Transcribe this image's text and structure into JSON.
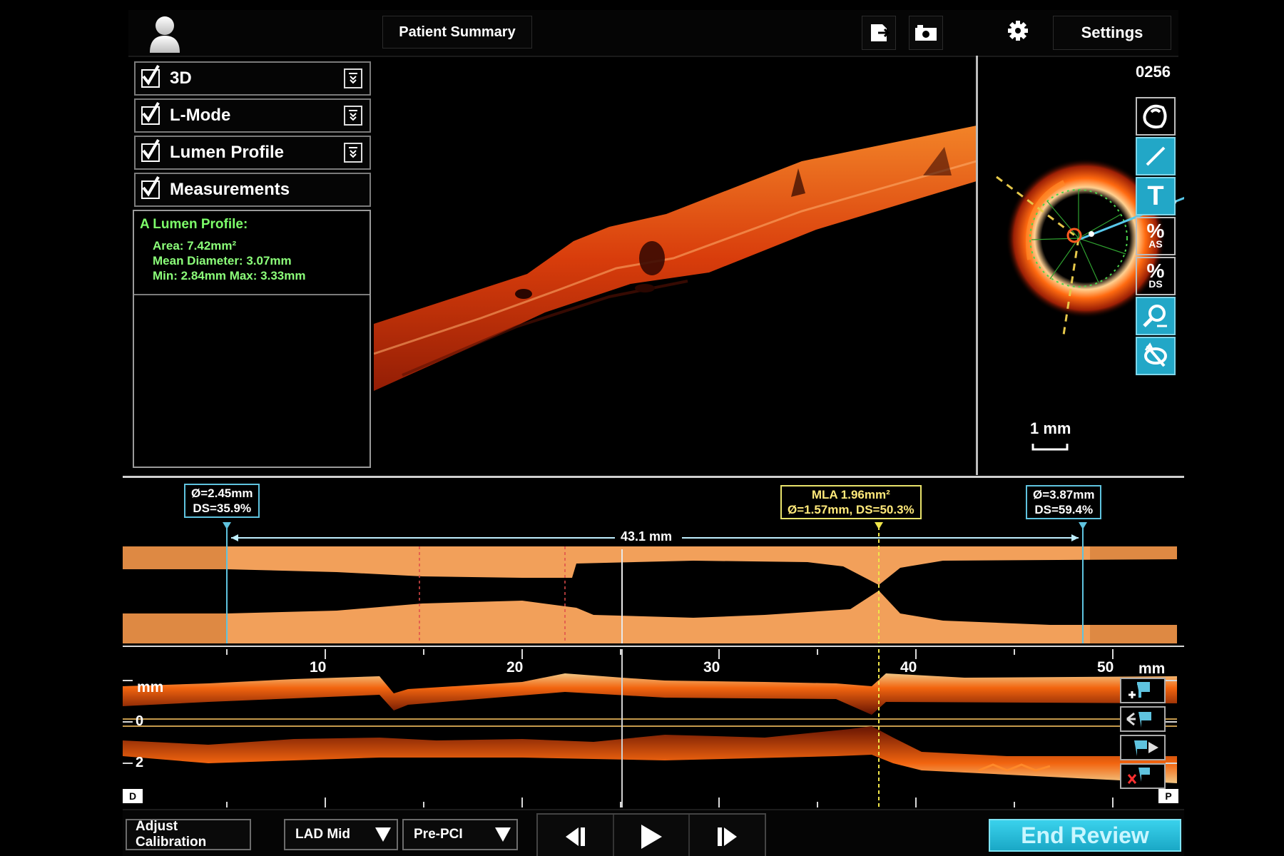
{
  "header": {
    "patient_summary_label": "Patient Summary",
    "settings_label": "Settings"
  },
  "icons": {
    "avatar": "user-avatar-icon",
    "export": "export-icon",
    "camera": "camera-icon",
    "settings": "gear-icon"
  },
  "panel": {
    "items": [
      {
        "label": "3D",
        "checked": true,
        "expandable": true
      },
      {
        "label": "L-Mode",
        "checked": true,
        "expandable": true
      },
      {
        "label": "Lumen Profile",
        "checked": true,
        "expandable": true
      },
      {
        "label": "Measurements",
        "checked": true,
        "expandable": false
      }
    ],
    "lumen_profile": {
      "title": "A Lumen Profile:",
      "area": "Area: 7.42mm²",
      "mean_diameter": "Mean Diameter: 3.07mm",
      "min_max": "Min: 2.84mm   Max: 3.33mm"
    }
  },
  "view": {
    "frame_number": "0256",
    "scale_label": "1 mm"
  },
  "tools": [
    {
      "icon": "lumen-trace-icon",
      "active": false
    },
    {
      "icon": "line-measure-icon",
      "active": true
    },
    {
      "icon": "text-annotation-icon",
      "text": "T",
      "active": true
    },
    {
      "icon": "percent-area-stenosis-icon",
      "text": "%",
      "sub": "AS",
      "active": false
    },
    {
      "icon": "percent-diameter-stenosis-icon",
      "text": "%",
      "sub": "DS",
      "active": false
    },
    {
      "icon": "zoom-icon",
      "active": true
    },
    {
      "icon": "reset-orientation-icon",
      "active": true
    }
  ],
  "lumen_band": {
    "ref_left": {
      "line1": "Ø=2.45mm",
      "line2": "DS=35.9%"
    },
    "mla": {
      "line1": "MLA 1.96mm²",
      "line2": "Ø=1.57mm, DS=50.3%"
    },
    "ref_right": {
      "line1": "Ø=3.87mm",
      "line2": "DS=59.4%"
    },
    "length_label": "43.1 mm"
  },
  "lmode": {
    "axis_ticks": [
      "10",
      "20",
      "30",
      "40",
      "50"
    ],
    "axis_unit": "mm",
    "depth_unit": "mm",
    "depth_ticks": [
      "0",
      "2"
    ],
    "distal_label": "D",
    "proximal_label": "P"
  },
  "bottom": {
    "adjust_calibration": "Adjust Calibration",
    "vessel_select": "LAD Mid",
    "procedure_select": "Pre-PCI",
    "end_review": "End Review"
  },
  "colors": {
    "oct_tissue": "#ff6a10",
    "lumen_band": "#f2a05a",
    "reference_line": "#5fc3df",
    "mla_line": "#f0e64a",
    "measurement_text": "#7dff6a",
    "accent_button": "#22a7c7"
  }
}
